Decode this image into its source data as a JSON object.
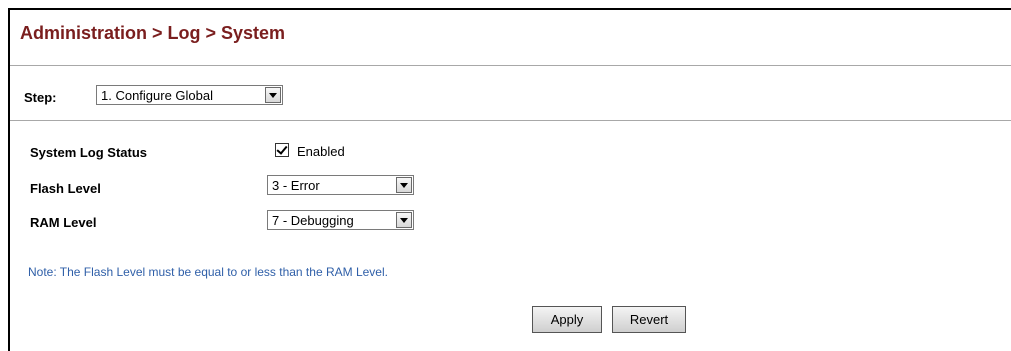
{
  "header": {
    "title": "Administration > Log > System"
  },
  "step": {
    "label": "Step:",
    "selected": "1. Configure Global"
  },
  "form": {
    "system_log_status": {
      "label": "System Log Status",
      "checked": true,
      "checkbox_label": "Enabled"
    },
    "flash_level": {
      "label": "Flash Level",
      "selected": "3 - Error"
    },
    "ram_level": {
      "label": "RAM Level",
      "selected": "7 - Debugging"
    }
  },
  "note": "Note: The Flash Level must be equal to or less than the RAM Level.",
  "buttons": {
    "apply": "Apply",
    "revert": "Revert"
  },
  "colors": {
    "title": "#7a1e1e",
    "note": "#2f5fa8"
  },
  "icons": {
    "dropdown": "chevron-down-icon",
    "checkbox": "checkmark-icon"
  }
}
